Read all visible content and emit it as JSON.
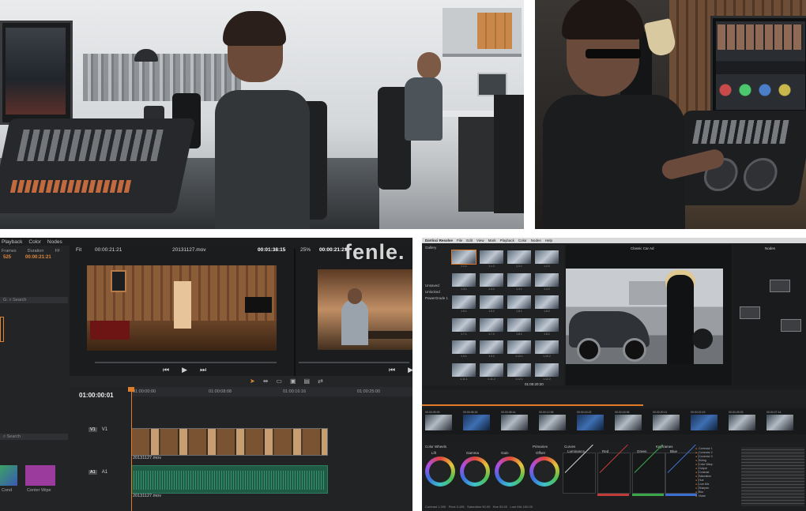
{
  "watermark": "fenle.",
  "edit": {
    "menu": [
      "Playback",
      "Color",
      "Nodes"
    ],
    "info_headers": [
      "Frames",
      "Duration",
      "FF"
    ],
    "info_values": [
      "525",
      "00:00:21:21"
    ],
    "search1": "Search",
    "search2": "Search",
    "filter_label": "G:",
    "source_fit": "Fit",
    "source_tc": "00:00:21:21",
    "clip_name": "20131127.mov",
    "source_duration": "00:01:38:15",
    "record_tc": "00:00:21:21",
    "zoom": "25%",
    "timeline_tc": "01:00:00:01",
    "ruler": [
      "01:00:00:00",
      "01:00:08:08",
      "01:00:16:16",
      "01:00:25:00"
    ],
    "v1_badge": "V1",
    "v1_label": "V1",
    "a1_badge": "A1",
    "a1_label": "A1",
    "video_clip_label": "20131127.mov",
    "audio_clip_label": "20131127.mov",
    "thumb_labels": [
      "Cond",
      "Center Wipe"
    ]
  },
  "color": {
    "app_title": "DaVinci Resolve",
    "menu": [
      "File",
      "Edit",
      "View",
      "Mark",
      "Playback",
      "Color",
      "Nodes",
      "Help"
    ],
    "gallery_labels": [
      "Gallery",
      "Unsaved",
      "Unlocked",
      "PowerGrade 1"
    ],
    "viewer_title": "Classic Car Ad",
    "viewer_tc": "01:00:20:20",
    "nodes_label": "Nodes",
    "stills": [
      "1.1.1",
      "1.1.2",
      "1.2.1",
      "1.2.2",
      "1.3.1",
      "1.3.2",
      "1.4.1",
      "1.4.2",
      "1.5.1",
      "1.5.2",
      "1.6.1",
      "1.6.2",
      "1.7.1",
      "1.7.2",
      "1.8.1",
      "1.8.2",
      "1.9.1",
      "1.9.2",
      "1.10.1",
      "1.10.2",
      "1.11.1",
      "1.11.2",
      "1.12.1",
      "1.12.2"
    ],
    "clip_tcs": [
      "00:00:05:09",
      "00:00:06:24",
      "00:00:08:14",
      "00:00:12:06",
      "00:00:15:22",
      "00:00:18:08",
      "00:00:20:11",
      "00:00:22:19",
      "00:00:25:03",
      "00:00:27:14"
    ],
    "wheel_labels": [
      "Lift",
      "Gamma",
      "Gain",
      "Offset"
    ],
    "wheel_section": "Color Wheels",
    "primaries_label": "Primaries",
    "curves_section": "Curves",
    "curve_labels": [
      "Luminance",
      "Red",
      "Green",
      "Blue"
    ],
    "keyframes_label": "Keyframes",
    "keyframe_items": [
      "Corrector 1",
      "Corrector 2",
      "Corrector 3",
      "Sizing",
      "Color Warp",
      "Output",
      "Contrast",
      "Saturation",
      "Hue",
      "Lum Mix",
      "Sharpen",
      "Blur",
      "Noise"
    ],
    "footer": [
      "Contrast 1.000",
      "Pivot 0.435",
      "Saturation 50.00",
      "Hue 50.00",
      "Lum Mix 100.00"
    ],
    "colors": {
      "accent": "#e07b2a",
      "red": "#c23b3b",
      "green": "#3aa84a",
      "blue": "#3b6fd0"
    }
  }
}
